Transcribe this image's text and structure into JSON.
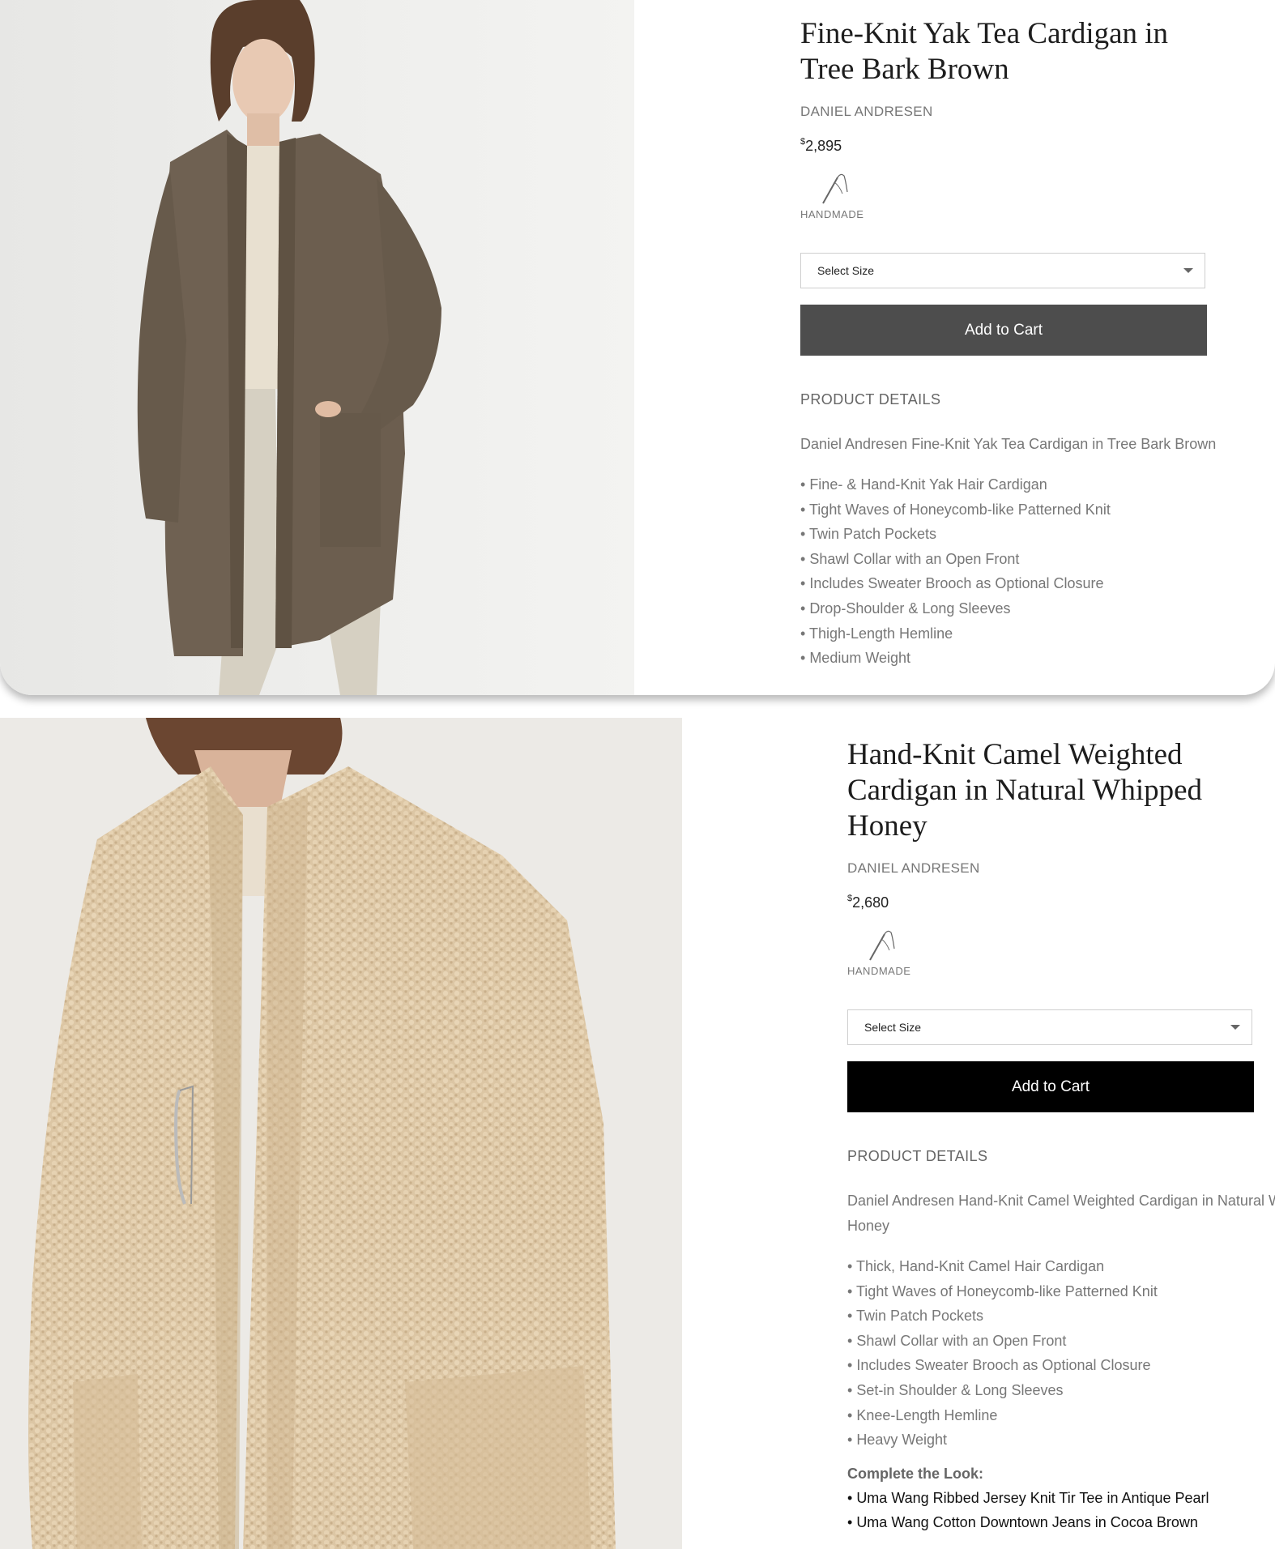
{
  "products": [
    {
      "title": "Fine-Knit Yak Tea Cardigan in Tree Bark Brown",
      "brand": "DANIEL ANDRESEN",
      "price_symbol": "$",
      "price": "2,895",
      "badge_label": "HANDMADE",
      "select_placeholder": "Select Size",
      "add_to_cart_label": "Add to Cart",
      "details_heading": "PRODUCT DETAILS",
      "description": "Daniel Andresen Fine-Knit Yak Tea Cardigan in Tree Bark Brown",
      "features": [
        "Fine- & Hand-Knit Yak Hair Cardigan",
        "Tight Waves of Honeycomb-like Patterned Knit",
        "Twin Patch Pockets",
        "Shawl Collar with an Open Front",
        "Includes Sweater Brooch as Optional Closure",
        "Drop-Shoulder & Long Sleeves",
        "Thigh-Length Hemline",
        "Medium Weight"
      ],
      "cart_button_color": "#4d4d4d",
      "garment_color": "#6f6152"
    },
    {
      "title": "Hand-Knit Camel Weighted Cardigan in Natural Whipped Honey",
      "brand": "DANIEL ANDRESEN",
      "price_symbol": "$",
      "price": "2,680",
      "badge_label": "HANDMADE",
      "select_placeholder": "Select Size",
      "add_to_cart_label": "Add to Cart",
      "details_heading": "PRODUCT DETAILS",
      "description": "Daniel Andresen Hand-Knit Camel Weighted Cardigan in Natural Whipped Honey",
      "features": [
        "Thick, Hand-Knit Camel Hair Cardigan",
        "Tight Waves of Honeycomb-like Patterned Knit",
        "Twin Patch Pockets",
        "Shawl Collar with an Open Front",
        "Includes Sweater Brooch as Optional Closure",
        "Set-in Shoulder & Long Sleeves",
        "Knee-Length Hemline",
        "Heavy Weight"
      ],
      "complete_look_heading": "Complete the Look:",
      "complete_look": [
        "Uma Wang Ribbed Jersey Knit Tir Tee in Antique Pearl",
        "Uma Wang Cotton Downtown Jeans in Cocoa Brown"
      ],
      "cart_button_color": "#000000",
      "garment_color": "#dcc6a4"
    }
  ]
}
